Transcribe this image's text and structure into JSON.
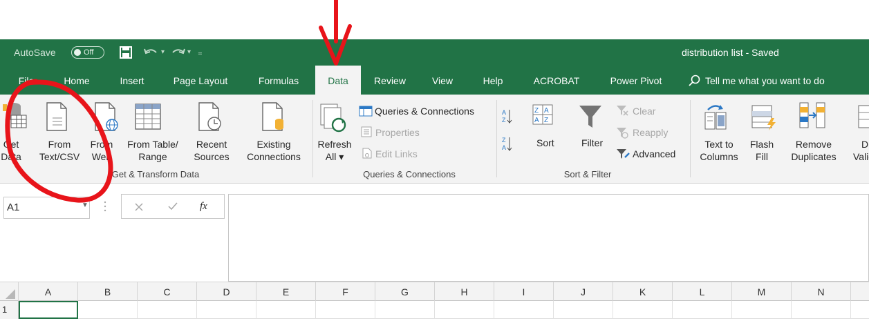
{
  "titlebar": {
    "autosave_label": "AutoSave",
    "autosave_state": "Off",
    "document_title": "distribution list  -  Saved"
  },
  "tabs": [
    {
      "label": "File"
    },
    {
      "label": "Home"
    },
    {
      "label": "Insert"
    },
    {
      "label": "Page Layout"
    },
    {
      "label": "Formulas"
    },
    {
      "label": "Data",
      "active": true
    },
    {
      "label": "Review"
    },
    {
      "label": "View"
    },
    {
      "label": "Help"
    },
    {
      "label": "ACROBAT"
    },
    {
      "label": "Power Pivot"
    }
  ],
  "tell_me": "Tell me what you want to do",
  "ribbon": {
    "get_transform": {
      "get_data": [
        "Get",
        "Data"
      ],
      "from_text_csv": [
        "From",
        "Text/CSV"
      ],
      "from_web": [
        "From",
        "Web"
      ],
      "from_table_range": [
        "From Table/",
        "Range"
      ],
      "recent_sources": [
        "Recent",
        "Sources"
      ],
      "existing_connections": [
        "Existing",
        "Connections"
      ],
      "group_label": "Get & Transform Data"
    },
    "queries": {
      "refresh_all": [
        "Refresh",
        "All"
      ],
      "queries_connections": "Queries & Connections",
      "properties": "Properties",
      "edit_links": "Edit Links",
      "group_label": "Queries & Connections"
    },
    "sort_filter": {
      "sort": "Sort",
      "filter": "Filter",
      "clear": "Clear",
      "reapply": "Reapply",
      "advanced": "Advanced",
      "group_label": "Sort & Filter"
    },
    "data_tools": {
      "text_to_columns": [
        "Text to",
        "Columns"
      ],
      "flash_fill": [
        "Flash",
        "Fill"
      ],
      "remove_duplicates": [
        "Remove",
        "Duplicates"
      ],
      "data_validation": [
        "D",
        "Valid"
      ]
    }
  },
  "formula_bar": {
    "name_box": "A1",
    "fx": "fx",
    "formula": ""
  },
  "grid": {
    "columns": [
      "A",
      "B",
      "C",
      "D",
      "E",
      "F",
      "G",
      "H",
      "I",
      "J",
      "K",
      "L",
      "M",
      "N"
    ],
    "row_label": "1"
  },
  "colors": {
    "excel_green": "#217346",
    "ribbon_bg": "#f3f3f3",
    "annotation_red": "#e8141a"
  }
}
